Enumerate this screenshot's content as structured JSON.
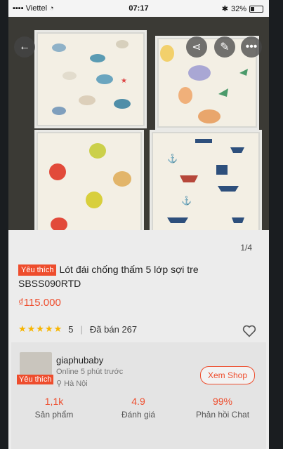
{
  "status": {
    "carrier": "Viettel",
    "time": "07:17",
    "battery": "32%"
  },
  "gallery": {
    "counter": "1/4"
  },
  "product": {
    "badge": "Yêu thích",
    "title": "Lót đái chống thấm 5 lớp sợi tre SBSS090RTD",
    "price": "₫115.000",
    "stars": "★★★★★",
    "rating": "5",
    "sold": "Đã bán 267"
  },
  "shop": {
    "badge": "Yêu thích",
    "name": "giaphubaby",
    "online": "Online 5 phút trước",
    "location": "Hà Nội",
    "view_shop_label": "Xem Shop",
    "stats": [
      {
        "value": "1,1k",
        "label": "Sản phẩm"
      },
      {
        "value": "4.9",
        "label": "Đánh giá"
      },
      {
        "value": "99%",
        "label": "Phản hồi Chat"
      }
    ]
  },
  "icons": {
    "back": "back-arrow-icon",
    "share": "share-icon",
    "edit": "edit-icon",
    "more": "more-icon",
    "heart": "heart-icon",
    "location": "location-pin-icon"
  },
  "colors": {
    "accent": "#ee4d2d",
    "star": "#f7b500"
  }
}
